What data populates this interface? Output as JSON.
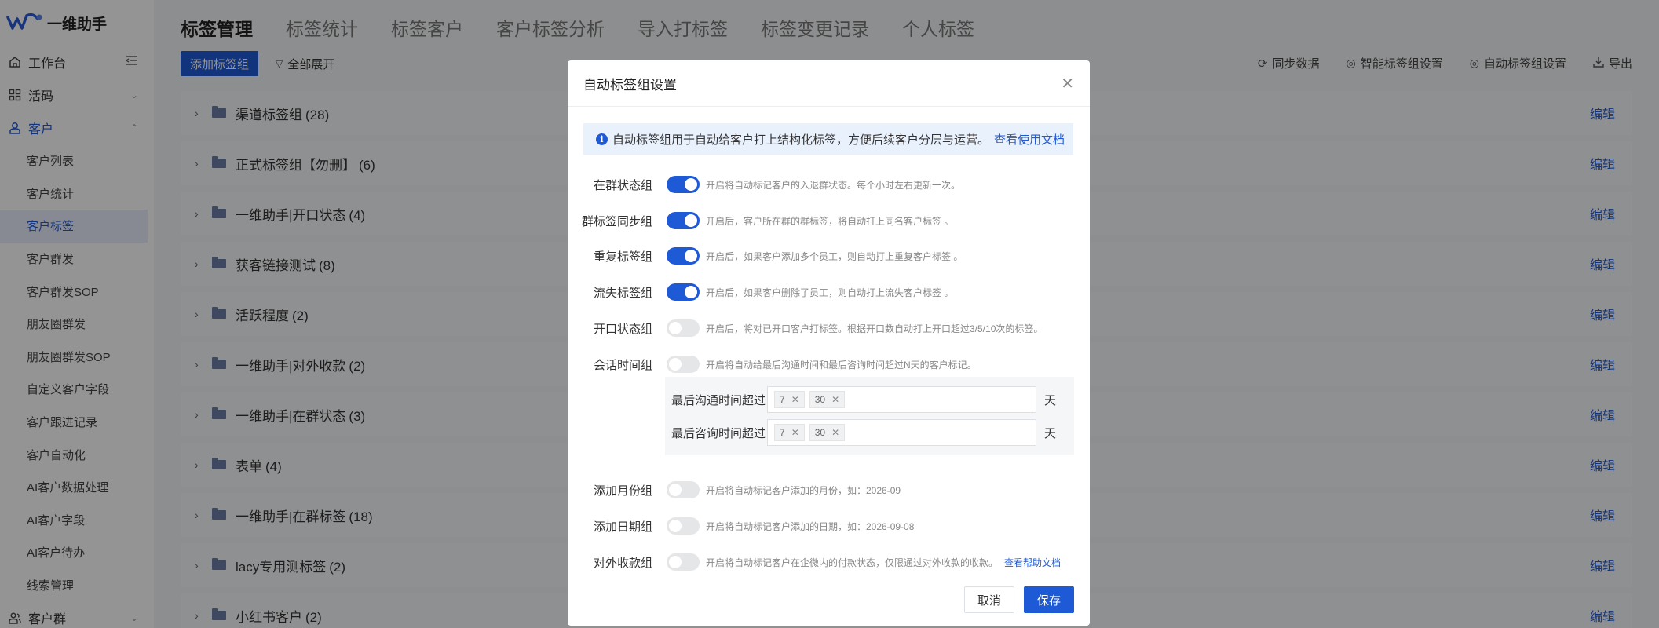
{
  "app": {
    "name": "一维助手"
  },
  "sidebar": {
    "groups": [
      {
        "label": "工作台",
        "icon": "home-icon"
      },
      {
        "label": "活码",
        "icon": "grid-icon"
      },
      {
        "label": "客户",
        "icon": "user-icon"
      },
      {
        "label": "客户群",
        "icon": "users-icon"
      }
    ],
    "items": [
      {
        "label": "客户列表"
      },
      {
        "label": "客户统计"
      },
      {
        "label": "客户标签",
        "active": true
      },
      {
        "label": "客户群发"
      },
      {
        "label": "客户群发SOP"
      },
      {
        "label": "朋友圈群发"
      },
      {
        "label": "朋友圈群发SOP"
      },
      {
        "label": "自定义客户字段"
      },
      {
        "label": "客户跟进记录"
      },
      {
        "label": "客户自动化"
      },
      {
        "label": "AI客户数据处理"
      },
      {
        "label": "AI客户字段"
      },
      {
        "label": "AI客户待办"
      },
      {
        "label": "线索管理"
      }
    ]
  },
  "tabs": [
    {
      "label": "标签管理",
      "active": true
    },
    {
      "label": "标签统计"
    },
    {
      "label": "标签客户"
    },
    {
      "label": "客户标签分析"
    },
    {
      "label": "导入打标签"
    },
    {
      "label": "标签变更记录"
    },
    {
      "label": "个人标签"
    }
  ],
  "toolbar": {
    "add_label": "添加标签组",
    "expand_label": "全部展开",
    "sync_label": "同步数据",
    "smart_label": "智能标签组设置",
    "auto_label": "自动标签组设置",
    "export_label": "导出"
  },
  "tag_groups": [
    {
      "name": "渠道标签组",
      "count": "(28)"
    },
    {
      "name": "正式标签组【勿删】",
      "count": "(6)"
    },
    {
      "name": "一维助手|开口状态",
      "count": "(4)"
    },
    {
      "name": "获客链接测试",
      "count": "(8)"
    },
    {
      "name": "活跃程度",
      "count": "(2)"
    },
    {
      "name": "一维助手|对外收款",
      "count": "(2)"
    },
    {
      "name": "一维助手|在群状态",
      "count": "(3)"
    },
    {
      "name": "表单",
      "count": "(4)"
    },
    {
      "name": "一维助手|在群标签",
      "count": "(18)"
    },
    {
      "name": "lacy专用测标签",
      "count": "(2)"
    },
    {
      "name": "小红书客户",
      "count": "(2)"
    }
  ],
  "edit_label": "编辑",
  "modal": {
    "title": "自动标签组设置",
    "info": "自动标签组用于自动给客户打上结构化标签，方便后续客户分层与运营。",
    "info_link": "查看使用文档",
    "settings": [
      {
        "label": "在群状态组",
        "on": true,
        "desc": "开启将自动标记客户的入退群状态。每个小时左右更新一次。"
      },
      {
        "label": "群标签同步组",
        "on": true,
        "desc": "开启后，客户所在群的群标签，将自动打上同名客户标签 。"
      },
      {
        "label": "重复标签组",
        "on": true,
        "desc": "开启后，如果客户添加多个员工，则自动打上重复客户标签 。"
      },
      {
        "label": "流失标签组",
        "on": true,
        "desc": "开启后，如果客户删除了员工，则自动打上流失客户标签 。"
      },
      {
        "label": "开口状态组",
        "on": false,
        "desc": "开启后，将对已开口客户打标签。根据开口数自动打上开口超过3/5/10次的标签。"
      },
      {
        "label": "会话时间组",
        "on": false,
        "desc": "开启将自动给最后沟通时间和最后咨询时间超过N天的客户标记。"
      },
      {
        "label": "添加月份组",
        "on": false,
        "desc": "开启将自动标记客户添加的月份，如：2026-09"
      },
      {
        "label": "添加日期组",
        "on": false,
        "desc": "开启将自动标记客户添加的日期，如：2026-09-08"
      },
      {
        "label": "对外收款组",
        "on": false,
        "desc": "开启将自动标记客户在企微内的付款状态，仅限通过对外收款的收款。",
        "link": "查看帮助文档"
      }
    ],
    "session": {
      "last_contact_label": "最后沟通时间超过",
      "last_consult_label": "最后咨询时间超过",
      "chips": [
        "7",
        "30"
      ],
      "unit": "天"
    },
    "cancel_label": "取消",
    "save_label": "保存"
  }
}
